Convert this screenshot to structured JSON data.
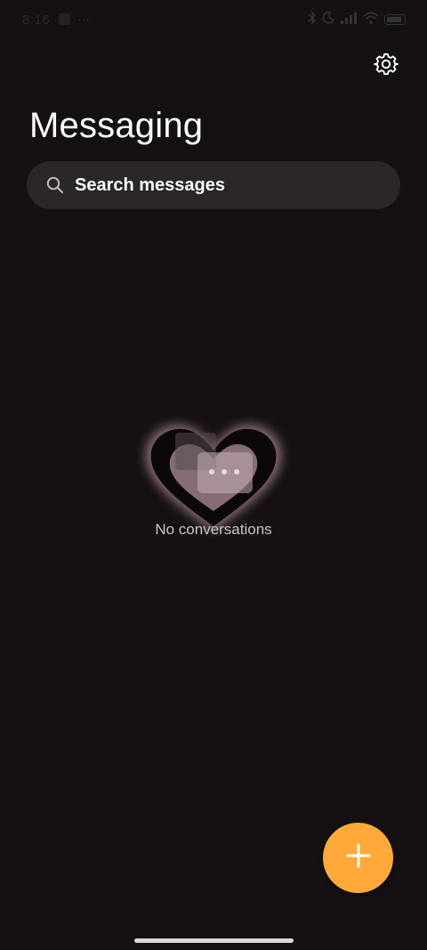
{
  "status_bar": {
    "time": "8:16",
    "icons": [
      "bluetooth-icon",
      "do-not-disturb-icon",
      "signal-icon",
      "wifi-icon",
      "battery-icon"
    ]
  },
  "header": {
    "title": "Messaging",
    "settings_icon": "gear-icon"
  },
  "search": {
    "placeholder": "Search messages",
    "icon": "search-icon"
  },
  "empty_state": {
    "message": "No conversations",
    "illustration": "chat-bubbles-in-heart"
  },
  "fab": {
    "icon": "plus-icon"
  },
  "colors": {
    "background": "#151012",
    "search_bg": "#2b2628",
    "accent": "#ffa93a",
    "text_secondary": "#c9c4c6"
  }
}
